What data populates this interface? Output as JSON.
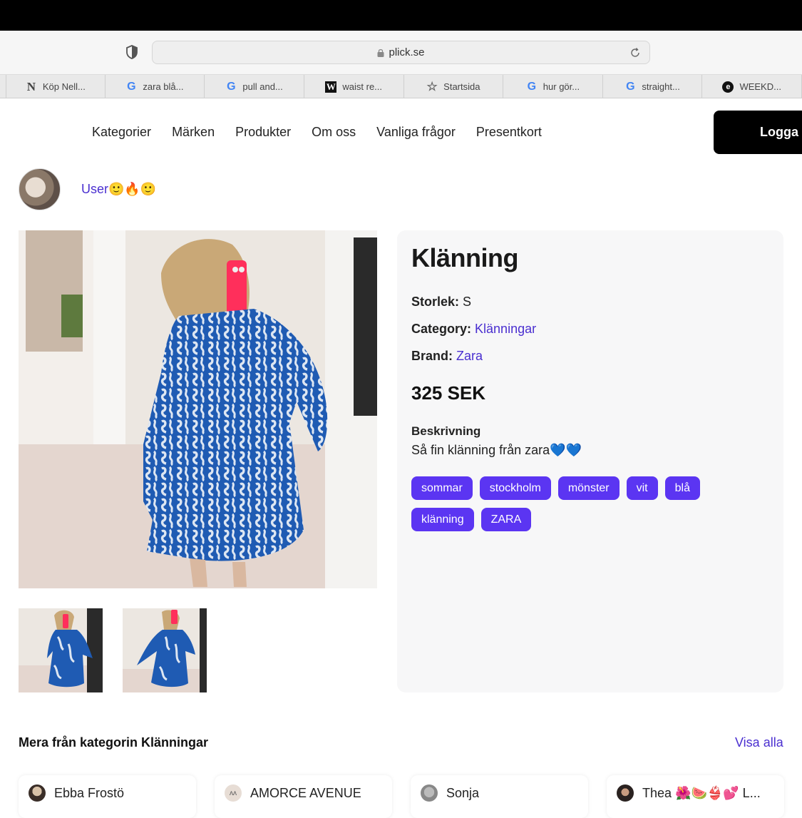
{
  "browser": {
    "url": "plick.se",
    "tabs": [
      {
        "icon": "N",
        "label": "Köp Nell..."
      },
      {
        "icon": "google-icon",
        "label": "zara blå..."
      },
      {
        "icon": "google-icon",
        "label": "pull and..."
      },
      {
        "icon": "W",
        "label": "waist re..."
      },
      {
        "icon": "star-icon",
        "label": "Startsida"
      },
      {
        "icon": "google-icon",
        "label": "hur gör..."
      },
      {
        "icon": "google-icon",
        "label": "straight..."
      },
      {
        "icon": "e",
        "label": "WEEKD..."
      }
    ]
  },
  "nav": {
    "links": [
      "Kategorier",
      "Märken",
      "Produkter",
      "Om oss",
      "Vanliga frågor",
      "Presentkort"
    ],
    "login": "Logga"
  },
  "seller": {
    "name": "User🙂🔥🙂"
  },
  "product": {
    "title": "Klänning",
    "size_label": "Storlek:",
    "size_value": "S",
    "category_label": "Category:",
    "category_value": "Klänningar",
    "brand_label": "Brand:",
    "brand_value": "Zara",
    "price": "325 SEK",
    "description_heading": "Beskrivning",
    "description": "Så fin klänning från zara💙💙",
    "tags": [
      "sommar",
      "stockholm",
      "mönster",
      "vit",
      "blå",
      "klänning",
      "ZARA"
    ]
  },
  "more": {
    "heading": "Mera från kategorin Klänningar",
    "see_all": "Visa alla",
    "sellers": [
      "Ebba Frostö",
      "AMORCE AVENUE",
      "Sonja",
      "Thea 🌺🍉👙💕 L..."
    ]
  },
  "colors": {
    "accent": "#5b35f2",
    "link": "#4a2fd0",
    "dress_blue": "#1f5bb3"
  }
}
